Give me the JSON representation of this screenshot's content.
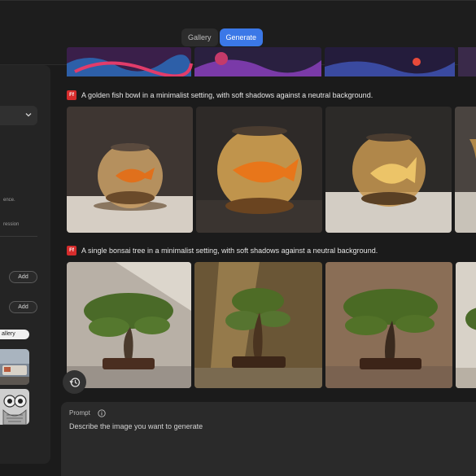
{
  "header": {
    "tabs": [
      {
        "label": "Gallery",
        "active": false
      },
      {
        "label": "Generate",
        "active": true
      }
    ]
  },
  "left_panel": {
    "text_fragments": [
      "ence.",
      "ression"
    ],
    "buttons": [
      {
        "label": "Add"
      },
      {
        "label": "Add"
      }
    ],
    "gallery_pill": "allery"
  },
  "feed": {
    "badge_label": "Ff",
    "prompts": [
      {
        "text": "A golden fish bowl in a minimalist setting, with soft shadows against a neutral background."
      },
      {
        "text": "A single bonsai tree in a minimalist setting, with soft shadows against a neutral background."
      }
    ]
  },
  "composer": {
    "label": "Prompt",
    "placeholder": "Describe the image you want to generate"
  },
  "colors": {
    "accent": "#3b78e7",
    "badge": "#d62c2c",
    "background": "#1b1b1b",
    "panel": "#242424"
  }
}
